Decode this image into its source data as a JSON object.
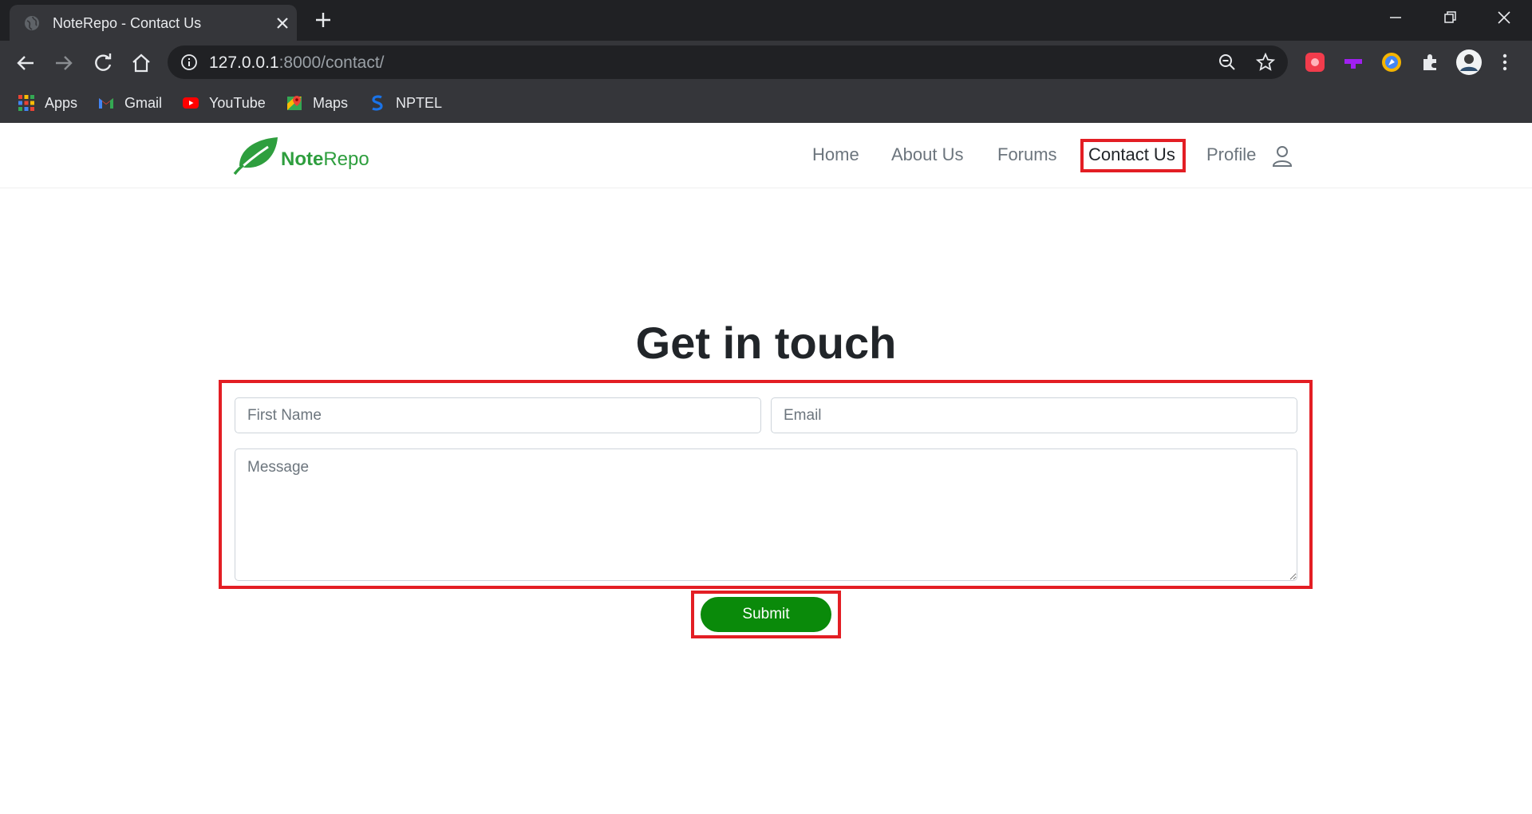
{
  "browser": {
    "tab_title": "NoteRepo - Contact Us",
    "url_host": "127.0.0.1",
    "url_rest": ":8000/contact/",
    "bookmarks": [
      {
        "label": "Apps",
        "icon": "apps-grid-icon"
      },
      {
        "label": "Gmail",
        "icon": "gmail-icon"
      },
      {
        "label": "YouTube",
        "icon": "youtube-icon"
      },
      {
        "label": "Maps",
        "icon": "maps-icon"
      },
      {
        "label": "NPTEL",
        "icon": "nptel-icon"
      }
    ]
  },
  "site": {
    "brand_bold": "Note",
    "brand_rest": "Repo",
    "nav": {
      "home": "Home",
      "about": "About Us",
      "forums": "Forums",
      "contact": "Contact Us",
      "profile": "Profile"
    }
  },
  "contact": {
    "heading": "Get in touch",
    "first_name_placeholder": "First Name",
    "email_placeholder": "Email",
    "message_placeholder": "Message",
    "submit_label": "Submit"
  },
  "colors": {
    "brand_green": "#2e9e3e",
    "submit_green": "#0a8a0a",
    "highlight_red": "#e31e24"
  }
}
